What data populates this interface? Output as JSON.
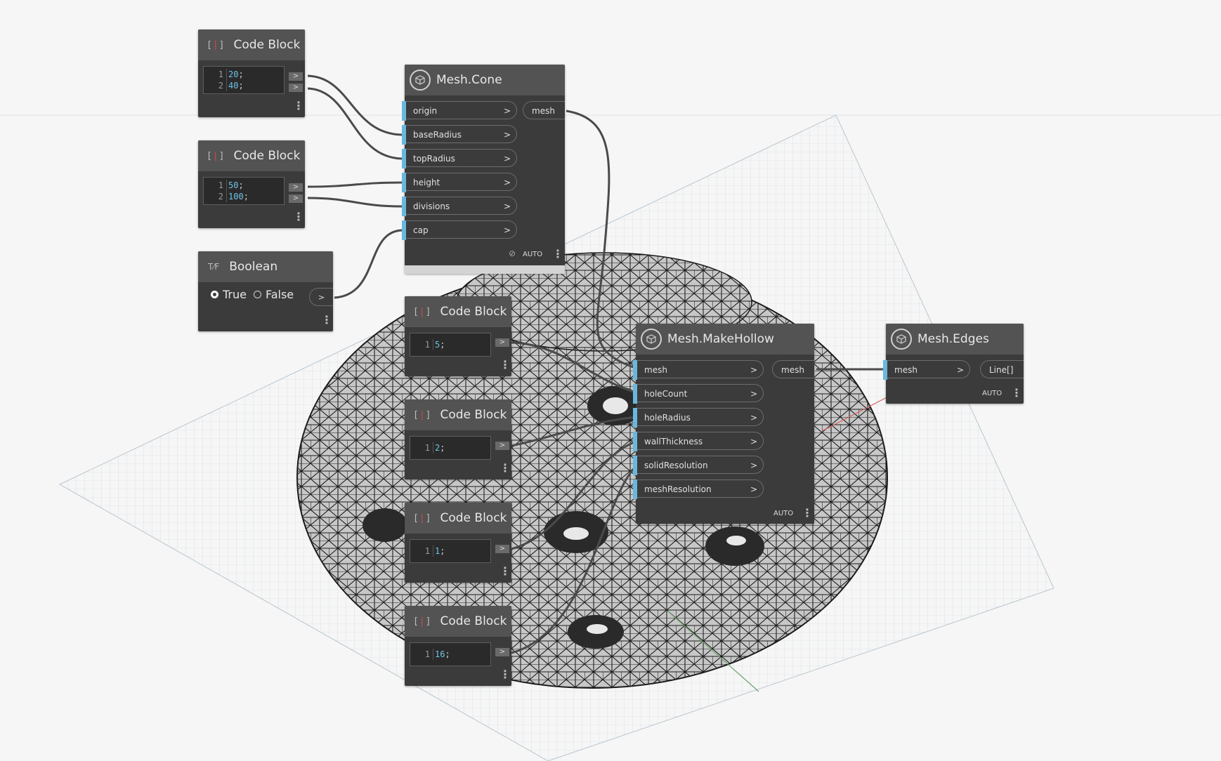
{
  "nodes": {
    "cb1": {
      "title": "Code Block",
      "lines": [
        {
          "n": "1",
          "v": "20"
        },
        {
          "n": "2",
          "v": "40"
        }
      ]
    },
    "cb2": {
      "title": "Code Block",
      "lines": [
        {
          "n": "1",
          "v": "50"
        },
        {
          "n": "2",
          "v": "100"
        }
      ]
    },
    "boolean": {
      "title": "Boolean",
      "true_label": "True",
      "false_label": "False",
      "selected": "True"
    },
    "mesh_cone": {
      "title": "Mesh.Cone",
      "inputs": [
        "origin",
        "baseRadius",
        "topRadius",
        "height",
        "divisions",
        "cap"
      ],
      "output": "mesh",
      "lacing": "AUTO"
    },
    "cb3": {
      "title": "Code Block",
      "lines": [
        {
          "n": "1",
          "v": "5"
        }
      ]
    },
    "cb4": {
      "title": "Code Block",
      "lines": [
        {
          "n": "1",
          "v": "2"
        }
      ]
    },
    "cb5": {
      "title": "Code Block",
      "lines": [
        {
          "n": "1",
          "v": "1"
        }
      ]
    },
    "cb6": {
      "title": "Code Block",
      "lines": [
        {
          "n": "1",
          "v": "16"
        }
      ]
    },
    "make_hollow": {
      "title": "Mesh.MakeHollow",
      "inputs": [
        "mesh",
        "holeCount",
        "holeRadius",
        "wallThickness",
        "solidResolution",
        "meshResolution"
      ],
      "output": "mesh",
      "lacing": "AUTO"
    },
    "mesh_edges": {
      "title": "Mesh.Edges",
      "inputs": [
        "mesh"
      ],
      "output": "Line[]",
      "lacing": "AUTO"
    }
  },
  "symbols": {
    "semicolon": ";",
    "chevron": ">",
    "port_arrow": ">"
  },
  "icons": {
    "code_block": "code-block-icon",
    "boolean": "boolean-icon",
    "mesh": "mesh-node-icon",
    "preview_off": "eye-hidden-icon",
    "menu": "more-vertical-icon"
  },
  "colors": {
    "background": "#f6f6f6",
    "node_body": "#3b3b3b",
    "node_header": "#535353",
    "input_marker": "#6ab7de",
    "code_number": "#6ec4ea",
    "wire": "#4a4a4a"
  }
}
